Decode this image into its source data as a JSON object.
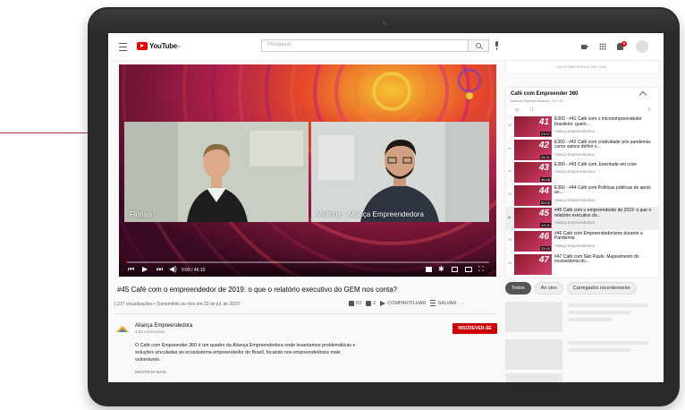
{
  "header": {
    "logo_text": "YouTube",
    "logo_sup": "BR",
    "search_placeholder": "Pesquisar",
    "notification_count": "9"
  },
  "video": {
    "speaker_left": "Florian",
    "speaker_right": "Vinicius - Aliança Empreendedora",
    "time": "0:00 / 46:10",
    "progress": 0.0
  },
  "details": {
    "title": "#45 Café com o empreendedor de 2019: o que o relatório executivo do GEM nos conta?",
    "meta": "1.227 visualizações • Transmitido ao vivo em 23 de jul. de 2020",
    "likes": "63",
    "dislikes": "2",
    "share_label": "COMPARTILHAR",
    "save_label": "SALVAR",
    "more_label": "..."
  },
  "channel": {
    "name": "Aliança Empreendedora",
    "subscribers": "4,56 mil inscritos",
    "subscribe_label": "INSCREVER-SE",
    "description": "O Café com Empreender 360 é um quadro da Aliança Empreendedora onde levantamos problemáticas e soluções vinculadas ao ecossistema empreendedor do Brasil, focando nos empreendedores mais vulneráveis.",
    "show_more": "MOSTRAR MAIS"
  },
  "chat": {
    "replay_label": "MOSTRAR REPLAY DO CHAT"
  },
  "playlist": {
    "title": "Café com Empreender 360",
    "subtitle": "Aliança Empreendedora - 44 / 62",
    "items": [
      {
        "index": "40",
        "num": "41",
        "duration": "23:07",
        "title": "E360 - #41 Café com o microempreendedor brasileiro: quem...",
        "channel": "Aliança Empreendedora",
        "active": false
      },
      {
        "index": "41",
        "num": "42",
        "duration": "28:31",
        "title": "E360 - #42 Café com criatividade pós pandemia: como vamos definir o...",
        "channel": "Aliança Empreendedora",
        "active": false
      },
      {
        "index": "42",
        "num": "43",
        "duration": "46:46",
        "title": "E360 - #43 Café com Juventude em crise",
        "channel": "Aliança Empreendedora",
        "active": false
      },
      {
        "index": "43",
        "num": "44",
        "duration": "50:00",
        "title": "E360 - #44 Café com Políticas públicas de apoio ao...",
        "channel": "Aliança Empreendedora",
        "active": false
      },
      {
        "index": "▶",
        "num": "45",
        "duration": "46:11",
        "title": "#45 Café com o empreendedor de 2019: o que o relatório executivo do...",
        "channel": "Aliança Empreendedora",
        "active": true
      },
      {
        "index": "45",
        "num": "46",
        "duration": "33:25",
        "title": "#46 Café com Empreendedorismo durante a Pandemia",
        "channel": "Aliança Empreendedora",
        "active": false
      },
      {
        "index": "46",
        "num": "47",
        "duration": "",
        "title": "#47 Café com São Paulo: Mapeamento do ecossistema do...",
        "channel": "",
        "active": false
      }
    ]
  },
  "chips": {
    "all": "Todos",
    "live": "Ao vivo",
    "recent": "Carregados recentemente"
  },
  "colors": {
    "brand_red": "#cc0000",
    "accent_magenta": "#d44070"
  }
}
